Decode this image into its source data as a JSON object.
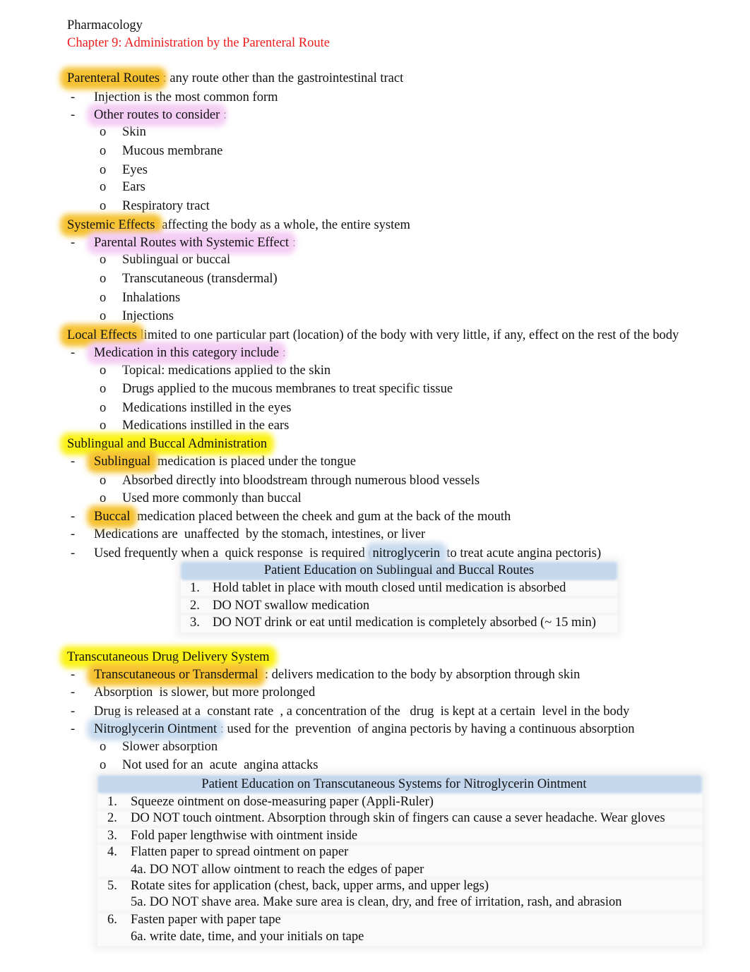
{
  "document": {
    "course": "Pharmacology",
    "chapter_title": "Chapter 9: Administration by the Parenteral Route"
  },
  "colors": {
    "chapter_title": "#ee1c1c",
    "highlight_orange": "#f6c232",
    "highlight_yellow": "#fbf21a",
    "highlight_pink": "#f4cdf4",
    "highlight_blue": "#c9dbee",
    "box_header": "#c4d7ec"
  },
  "parenteral": {
    "term": "Parenteral Routes",
    "definition": " : any route other than the gastrointestinal tract",
    "points": [
      "Injection is the most common form",
      "Other routes to consider"
    ],
    "colon": " :",
    "routes": [
      "Skin",
      "Mucous membrane",
      "Eyes",
      "Ears",
      "Respiratory tract"
    ]
  },
  "systemic": {
    "term": "Systemic Effects",
    "definition": ": affecting the body as a whole, the entire system",
    "subhead": "Parental Routes with Systemic Effect",
    "colon": " :",
    "routes": [
      "Sublingual or buccal",
      "Transcutaneous (transdermal)",
      "Inhalations",
      "Injections"
    ]
  },
  "local": {
    "term": "Local Effects",
    "definition": " limited to one particular part (location) of the body with very little, if any, effect on the rest of the body",
    "subhead": "Medication in this category include",
    "colon": "  :",
    "items": [
      "Topical: medications applied to the skin",
      "Drugs applied to the mucous membranes to treat specific tissue",
      "Medications instilled in the eyes",
      "Medications instilled in the ears"
    ]
  },
  "sublingual": {
    "heading": "Sublingual and Buccal Administration",
    "sublingual_term": "Sublingual",
    "sublingual_def": ": medication is placed under the tongue",
    "sublingual_items": [
      "Absorbed directly into bloodstream through numerous blood vessels",
      "Used more commonly than buccal"
    ],
    "buccal_term": "Buccal",
    "buccal_def": ": medication placed between the cheek and gum at the back of the mouth",
    "point_unaffected": "Medications are  unaffected  by the stomach, intestines, or liver",
    "point_quick_pre": "Used frequently when a  quick response  is required (",
    "point_quick_term": "nitroglycerin",
    "point_quick_post": "  to treat acute angina pectoris)",
    "education": {
      "title": "Patient Education on Sublingual and Buccal Routes",
      "items": [
        {
          "num": "1.",
          "text": "Hold tablet in place with mouth closed until medication is absorbed"
        },
        {
          "num": "2.",
          "text": "DO NOT swallow medication"
        },
        {
          "num": "3.",
          "text": "DO NOT drink or eat until medication is completely absorbed (~ 15 min)"
        }
      ]
    }
  },
  "transcutaneous": {
    "heading": "Transcutaneous Drug Delivery System",
    "term": "Transcutaneous or Transdermal",
    "definition": "  : delivers medication to the body by absorption through skin",
    "point_absorption": "Absorption  is slower, but more prolonged",
    "point_released": "Drug is released at a  constant rate  , a concentration of the   drug  is kept at a certain  level in the body",
    "nitro_term": "Nitroglycerin Ointment",
    "nitro_def": " : used for the  prevention  of angina pectoris by having a continuous absorption",
    "nitro_items": [
      "Slower absorption",
      "Not used for an  acute  angina attacks"
    ],
    "education": {
      "title": "Patient Education on Transcutaneous Systems for Nitroglycerin Ointment",
      "items": [
        {
          "num": "1.",
          "text": "Squeeze ointment on dose-measuring paper (Appli-Ruler)"
        },
        {
          "num": "2.",
          "text": "DO NOT touch ointment. Absorption through skin of fingers can cause a sever headache. Wear gloves"
        },
        {
          "num": "3.",
          "text": "Fold paper lengthwise with ointment inside"
        },
        {
          "num": "4.",
          "text": "Flatten paper to spread ointment on paper",
          "sub": "4a. DO NOT allow ointment to reach the edges of paper"
        },
        {
          "num": "5.",
          "text": "Rotate sites for application (chest, back, upper arms, and upper legs)",
          "sub": "5a. DO NOT shave area. Make sure area is clean, dry, and free of irritation, rash, and abrasion"
        },
        {
          "num": "6.",
          "text": "Fasten paper with paper tape",
          "sub": "6a. write date, time, and your initials on tape"
        }
      ]
    }
  },
  "glyphs": {
    "dash": "-",
    "bullet": "o"
  }
}
